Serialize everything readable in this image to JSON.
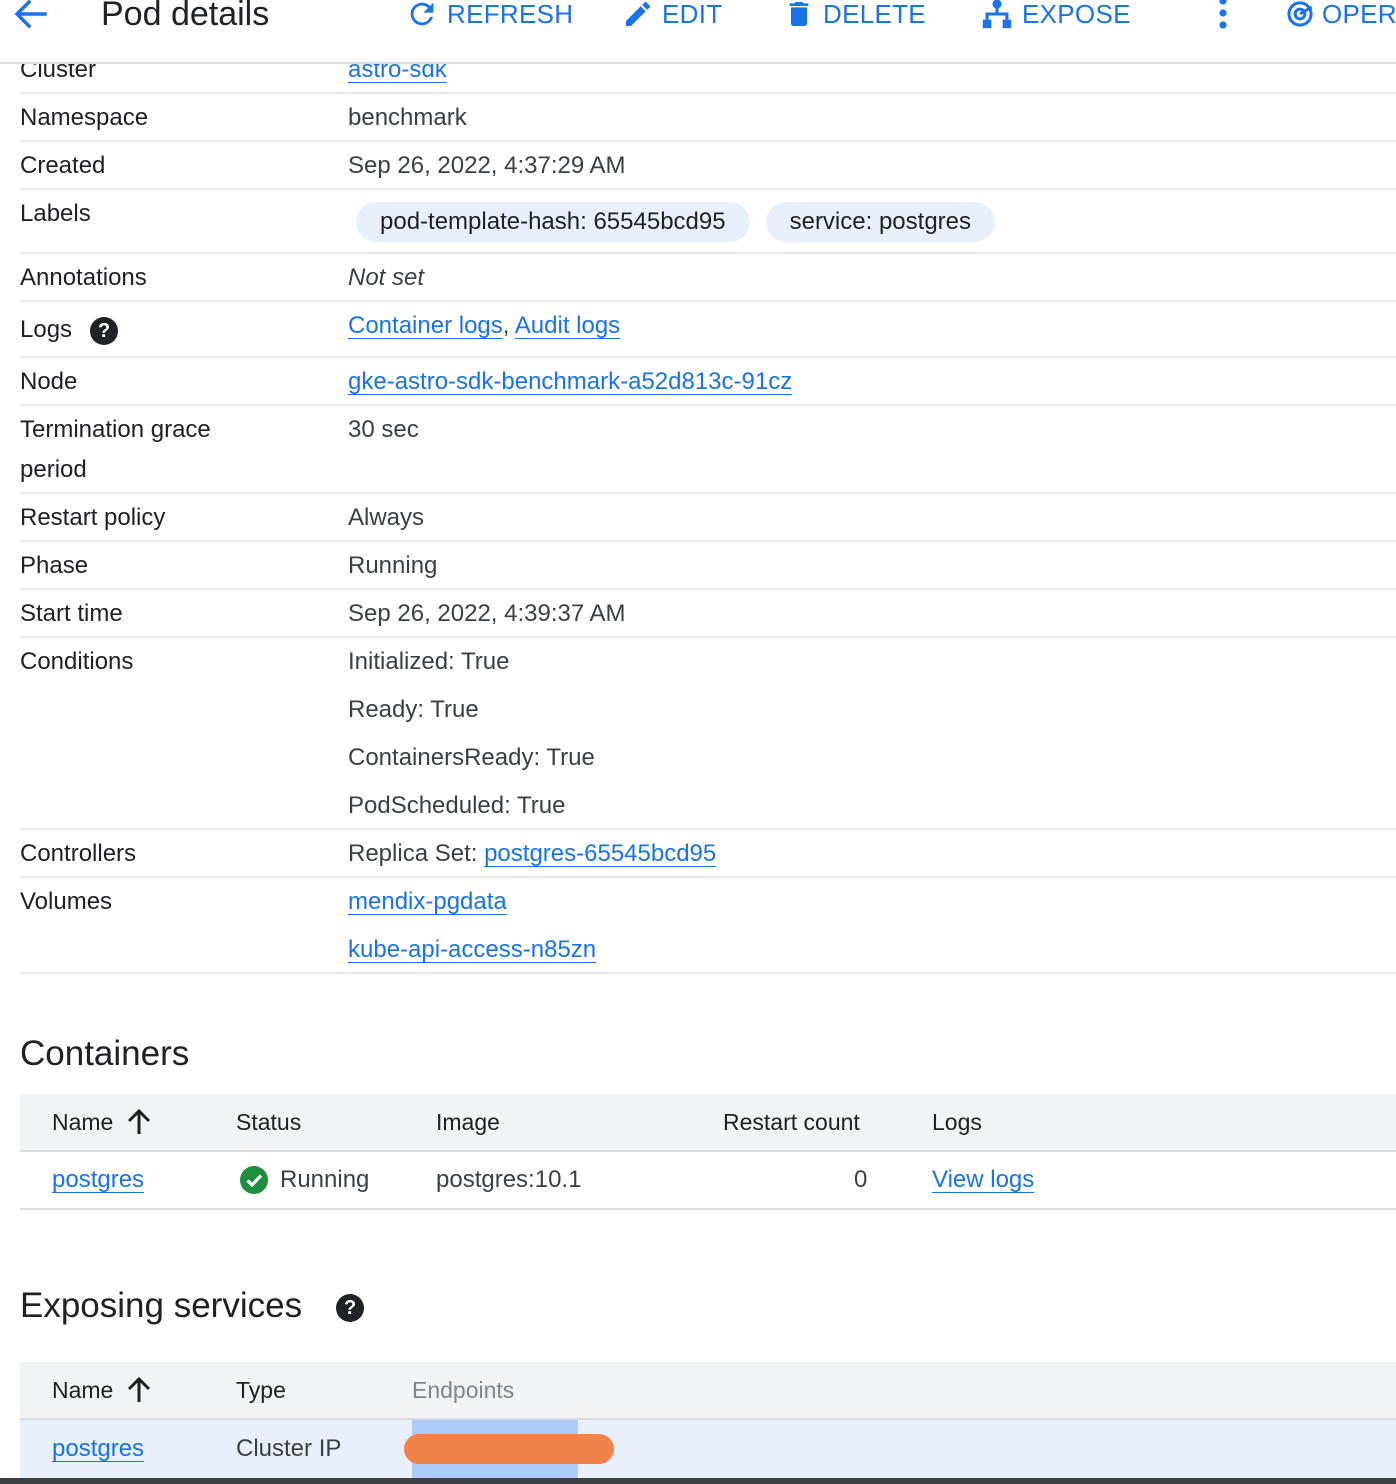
{
  "header": {
    "title": "Pod details",
    "actions": {
      "refresh": "REFRESH",
      "edit": "EDIT",
      "delete": "DELETE",
      "expose": "EXPOSE",
      "operate": "OPERA"
    },
    "accent_color": "#1a73e8"
  },
  "details": {
    "cluster": {
      "label": "Cluster",
      "value": "astro-sdk"
    },
    "namespace": {
      "label": "Namespace",
      "value": "benchmark"
    },
    "created": {
      "label": "Created",
      "value": "Sep 26, 2022, 4:37:29 AM"
    },
    "labels": {
      "label": "Labels",
      "chips": [
        "pod-template-hash: 65545bcd95",
        "service: postgres"
      ]
    },
    "annotations": {
      "label": "Annotations",
      "value": "Not set"
    },
    "logs": {
      "label": "Logs",
      "help": "?",
      "container_logs": "Container logs",
      "separator": ",",
      "audit_logs": "Audit logs"
    },
    "node": {
      "label": "Node",
      "value": "gke-astro-sdk-benchmark-a52d813c-91cz"
    },
    "termination": {
      "label_line1": "Termination grace",
      "label_line2": "period",
      "value": "30 sec"
    },
    "restart_policy": {
      "label": "Restart policy",
      "value": "Always"
    },
    "phase": {
      "label": "Phase",
      "value": "Running"
    },
    "start_time": {
      "label": "Start time",
      "value": "Sep 26, 2022, 4:39:37 AM"
    },
    "conditions": {
      "label": "Conditions",
      "items": [
        "Initialized: True",
        "Ready: True",
        "ContainersReady: True",
        "PodScheduled: True"
      ]
    },
    "controllers": {
      "label": "Controllers",
      "prefix": "Replica Set: ",
      "link": "postgres-65545bcd95"
    },
    "volumes": {
      "label": "Volumes",
      "items": [
        "mendix-pgdata",
        "kube-api-access-n85zn"
      ]
    }
  },
  "containers": {
    "title": "Containers",
    "columns": {
      "name": "Name",
      "status": "Status",
      "image": "Image",
      "restart_count": "Restart count",
      "logs": "Logs"
    },
    "rows": [
      {
        "name": "postgres",
        "status": "Running",
        "image": "postgres:10.1",
        "restart_count": "0",
        "logs": "View logs"
      }
    ]
  },
  "services": {
    "title": "Exposing services",
    "help": "?",
    "columns": {
      "name": "Name",
      "type": "Type",
      "endpoints": "Endpoints"
    },
    "rows": [
      {
        "name": "postgres",
        "type": "Cluster IP"
      }
    ]
  },
  "colors": {
    "link": "#1a73e8",
    "success": "#1e8e3e",
    "redaction": "#f0834a",
    "selection": "#aecbfa"
  }
}
